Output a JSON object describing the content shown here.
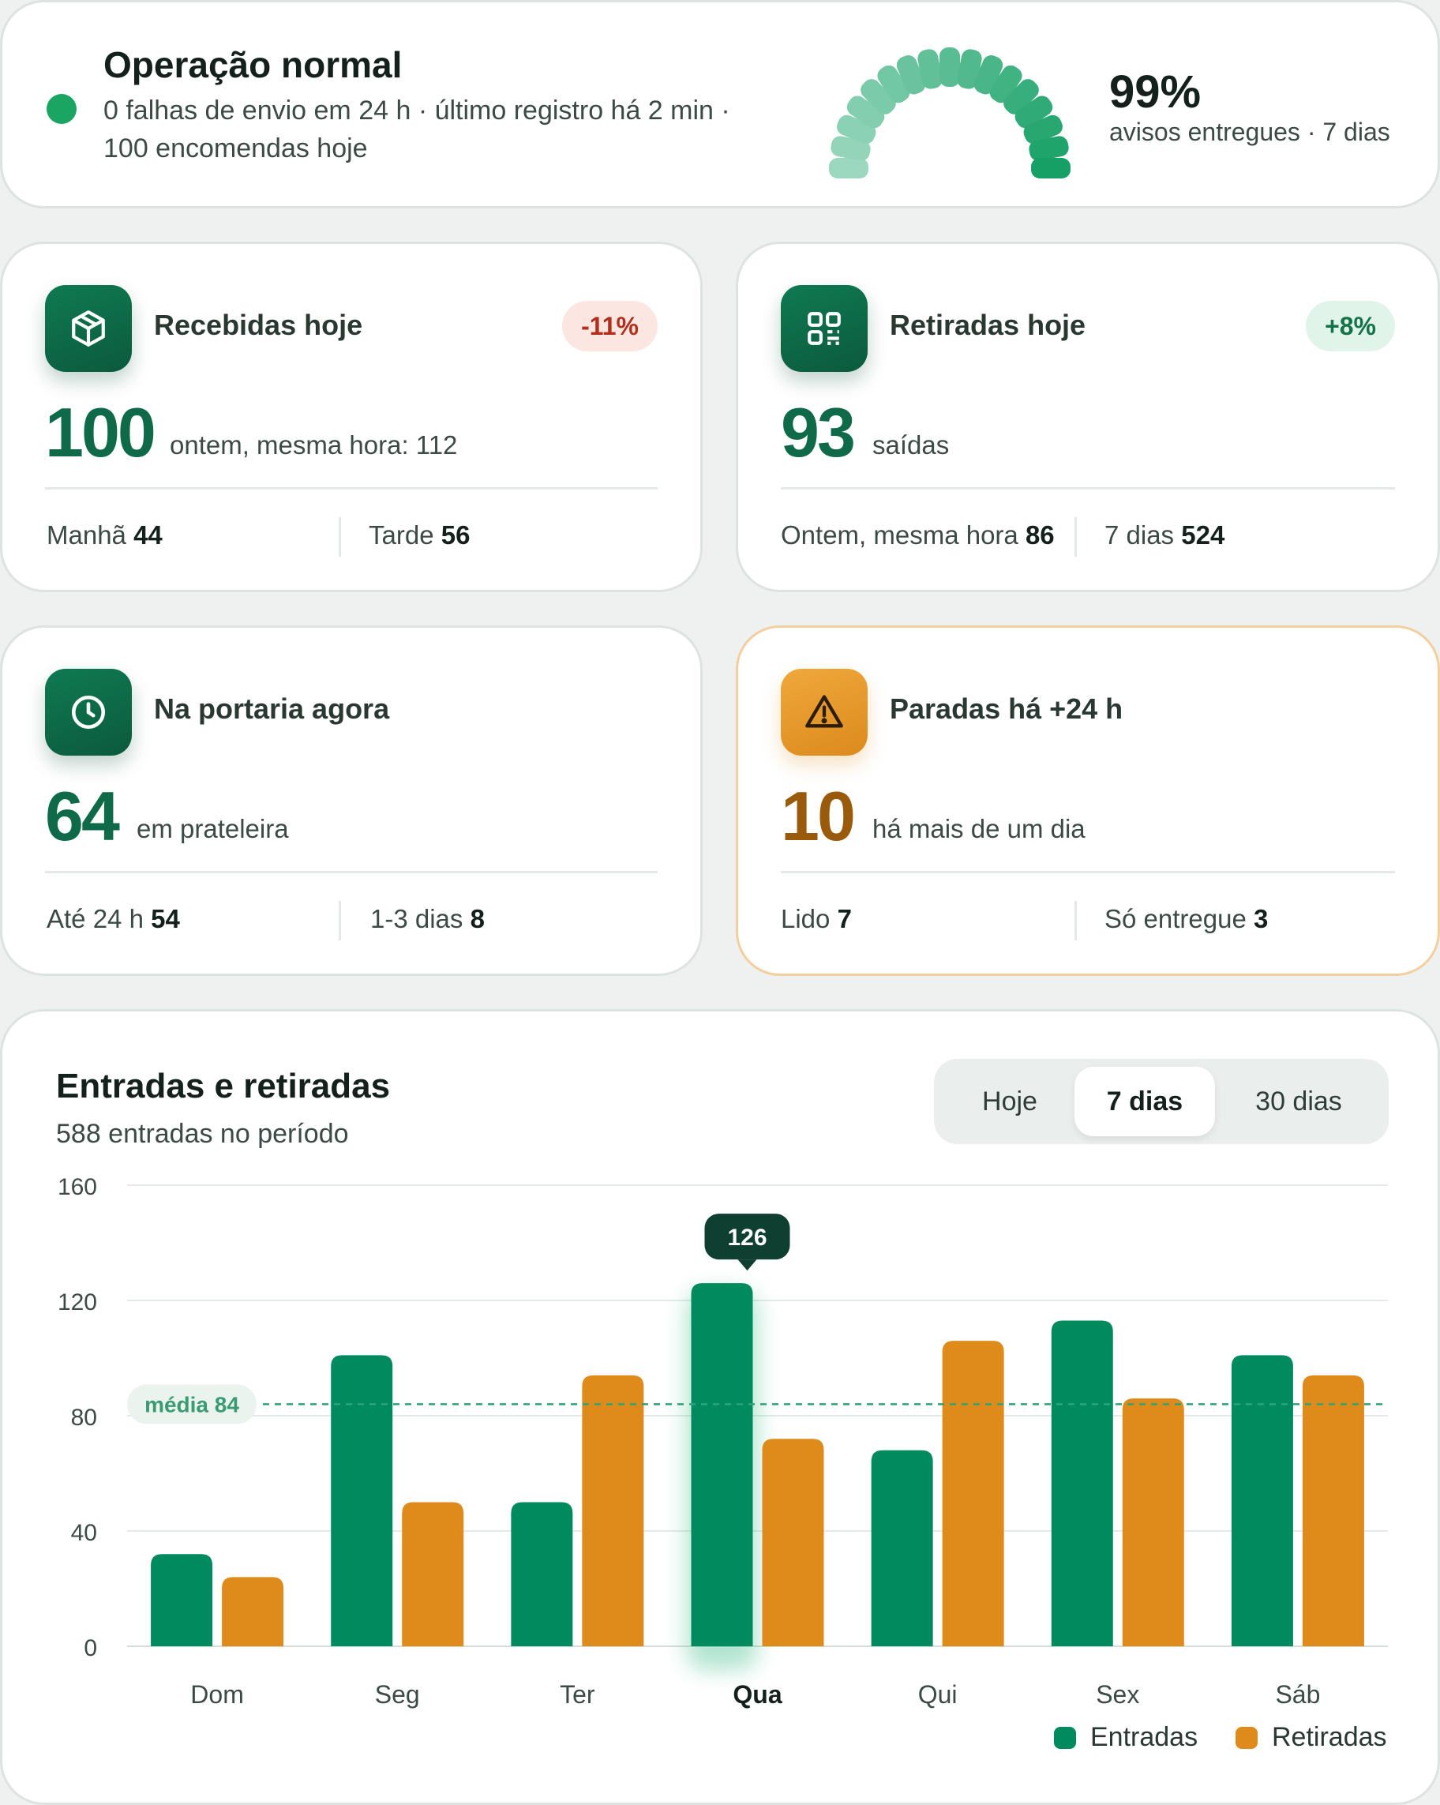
{
  "status": {
    "title": "Operação normal",
    "line1": "0 falhas de envio em 24 h · último registro há 2 min ·",
    "line2": "100 encomendas hoje",
    "gauge_value": "99%",
    "gauge_label": "avisos entregues · 7 dias",
    "gauge_fraction": 0.99,
    "status_color": "#1aa563"
  },
  "kpis": {
    "received": {
      "title": "Recebidas hoje",
      "icon": "package-icon",
      "badge": "-11%",
      "value": "100",
      "unit": "ontem, mesma hora: 112",
      "foot1_label": "Manhã",
      "foot1_value": "44",
      "foot2_label": "Tarde",
      "foot2_value": "56"
    },
    "picked": {
      "title": "Retiradas hoje",
      "icon": "qr-code-icon",
      "badge": "+8%",
      "value": "93",
      "unit": "saídas",
      "foot1_label": "Ontem, mesma hora",
      "foot1_value": "86",
      "foot2_label": "7 dias",
      "foot2_value": "524"
    },
    "at_desk": {
      "title": "Na portaria agora",
      "icon": "clock-icon",
      "value": "64",
      "unit": "em prateleira",
      "foot1_label": "Até 24 h",
      "foot1_value": "54",
      "foot2_label": "1-3 dias",
      "foot2_value": "8"
    },
    "stalled": {
      "title": "Paradas há +24 h",
      "icon": "warning-icon",
      "value": "10",
      "unit": "há mais de um dia",
      "foot1_label": "Lido",
      "foot1_value": "7",
      "foot2_label": "Só entregue",
      "foot2_value": "3"
    }
  },
  "chart": {
    "title": "Entradas e retiradas",
    "subtitle": "588 entradas no período",
    "ranges": [
      "Hoje",
      "7 dias",
      "30 dias"
    ],
    "selected_range": "7 dias",
    "legend": [
      "Entradas",
      "Retiradas"
    ],
    "average_label": "média 84",
    "tooltip": "126"
  },
  "chart_data": {
    "type": "bar",
    "categories": [
      "Dom",
      "Seg",
      "Ter",
      "Qua",
      "Qui",
      "Sex",
      "Sáb"
    ],
    "series": [
      {
        "name": "Entradas",
        "values": [
          32,
          101,
          50,
          126,
          68,
          113,
          101
        ],
        "color": "#008a5e"
      },
      {
        "name": "Retiradas",
        "values": [
          24,
          50,
          94,
          72,
          106,
          86,
          94
        ],
        "color": "#de8b1b"
      }
    ],
    "yticks": [
      0,
      40,
      80,
      120,
      160
    ],
    "ylim": [
      0,
      160
    ],
    "average": 84,
    "highlight_category": "Qua",
    "grid": true,
    "legend_position": "bottom-right"
  }
}
